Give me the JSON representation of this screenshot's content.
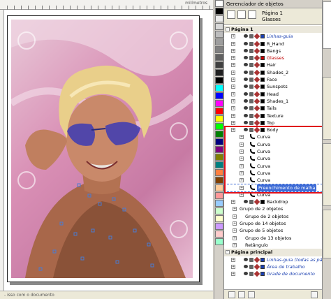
{
  "canvas": {
    "ruler_unit": "milímetros",
    "watermark_text": "Sebasti",
    "watermark_year": "2008",
    "status_text": "- isso com o documento"
  },
  "panel": {
    "title": "Gerenciador de objetos",
    "page_header": "Página 1",
    "layer_header": "Glasses"
  },
  "tree": [
    {
      "kind": "page",
      "label": "Página 1"
    },
    {
      "kind": "layer",
      "label": "Linhas-guia",
      "style": "italic-blue",
      "color": "#1a3fb0"
    },
    {
      "kind": "layer",
      "label": "R_Hand",
      "color": "#000000"
    },
    {
      "kind": "layer",
      "label": "Bangs",
      "color": "#000000"
    },
    {
      "kind": "layer",
      "label": "Glasses",
      "style": "red-label",
      "color": "#c00000"
    },
    {
      "kind": "layer",
      "label": "Hair",
      "color": "#000000"
    },
    {
      "kind": "layer",
      "label": "Shades_2",
      "color": "#000000"
    },
    {
      "kind": "layer",
      "label": "Face",
      "color": "#000000"
    },
    {
      "kind": "layer",
      "label": "Sunspots",
      "color": "#000000"
    },
    {
      "kind": "layer",
      "label": "Head",
      "color": "#000000"
    },
    {
      "kind": "layer",
      "label": "Shades_1",
      "color": "#000000"
    },
    {
      "kind": "layer",
      "label": "Tails",
      "color": "#000000"
    },
    {
      "kind": "layer",
      "label": "Texture",
      "color": "#000000"
    },
    {
      "kind": "layer",
      "label": "Top",
      "color": "#000000"
    },
    {
      "kind": "layer",
      "label": "Body",
      "color": "#000000"
    },
    {
      "kind": "child",
      "label": "Curva"
    },
    {
      "kind": "child",
      "label": "Curva"
    },
    {
      "kind": "child",
      "label": "Curva"
    },
    {
      "kind": "child",
      "label": "Curva"
    },
    {
      "kind": "child",
      "label": "Curva"
    },
    {
      "kind": "child",
      "label": "Curva"
    },
    {
      "kind": "child",
      "label": "Curva"
    },
    {
      "kind": "child",
      "label": "Preenchimento de malha",
      "style": "selected"
    },
    {
      "kind": "child",
      "label": "Curva"
    },
    {
      "kind": "layer",
      "label": "Backdrop",
      "color": "#000000"
    },
    {
      "kind": "group",
      "label": "Grupo de 2 objetos"
    },
    {
      "kind": "group2",
      "label": "Grupo de 2 objetos"
    },
    {
      "kind": "group",
      "label": "Grupo de 14 objetos"
    },
    {
      "kind": "group",
      "label": "Grupo de 5 objetos"
    },
    {
      "kind": "group2",
      "label": "Grupo de 13 objetos"
    },
    {
      "kind": "group2",
      "label": "Retângulo"
    },
    {
      "kind": "page",
      "label": "Página principal"
    },
    {
      "kind": "layer",
      "label": "Linhas-guia (todas as pá",
      "style": "italic-blue",
      "color": "#1a3fb0"
    },
    {
      "kind": "layer",
      "label": "Área de trabalho",
      "style": "italic-blue",
      "color": "#1a3fb0"
    },
    {
      "kind": "layer",
      "label": "Grade de documento",
      "style": "italic-blue",
      "color": "#1a3fb0"
    }
  ],
  "side_tabs": [
    "Gerenciador de ob...",
    "Propriedades do obj...",
    "Marca Marcador",
    "Direções"
  ],
  "palette_colors": [
    "#ffffff",
    "#000000",
    "#ececec",
    "#d8d8d8",
    "#bdbdbd",
    "#9e9e9e",
    "#808080",
    "#606060",
    "#404040",
    "#202020",
    "#000000",
    "#00ffff",
    "#0000ff",
    "#ff00ff",
    "#ff0000",
    "#ffff00",
    "#00ff00",
    "#008000",
    "#000080",
    "#800080",
    "#808000",
    "#008080",
    "#ff8040",
    "#804000",
    "#ffcc99",
    "#ff9999",
    "#99ccff",
    "#ccffcc",
    "#ffffcc",
    "#cc99ff",
    "#ffcccc",
    "#99ffcc"
  ],
  "colors": {
    "highlight_frame": "#e0101a",
    "selection_bg": "#3d6bd6"
  }
}
